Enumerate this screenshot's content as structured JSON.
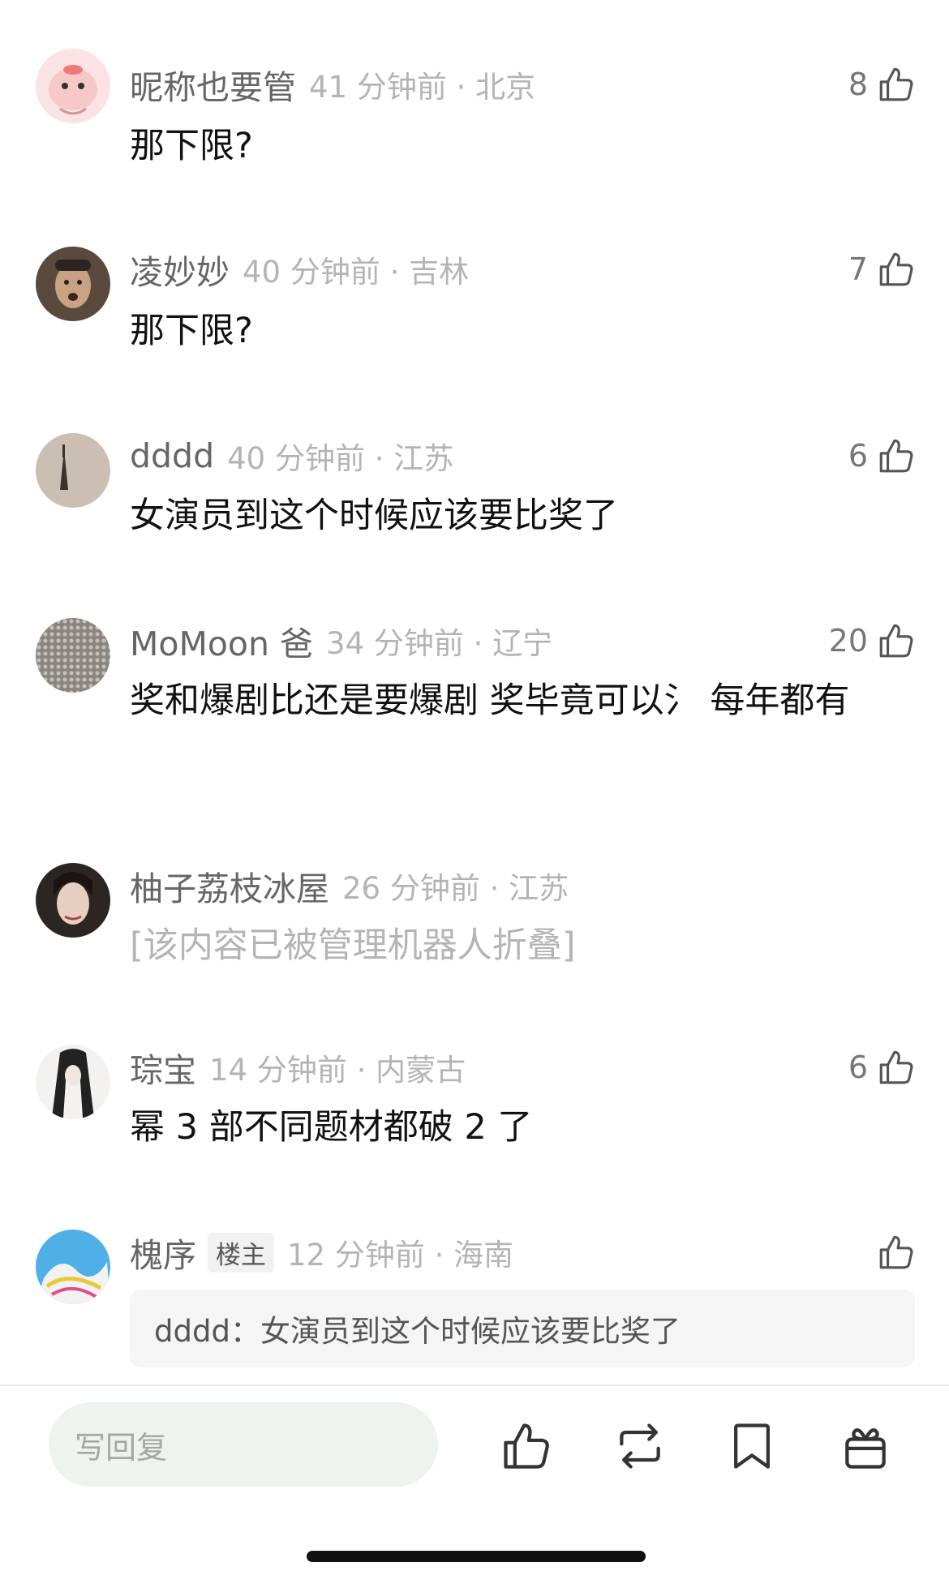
{
  "comments": [
    {
      "username": "昵称也要管",
      "time": "41 分钟前 · 北京",
      "likes": "8",
      "text": "那下限?"
    },
    {
      "username": "凌妙妙",
      "time": "40 分钟前 · 吉林",
      "likes": "7",
      "text": "那下限?"
    },
    {
      "username": "dddd",
      "time": "40 分钟前 · 江苏",
      "likes": "6",
      "text": "女演员到这个时候应该要比奖了"
    },
    {
      "username": "MoMoon 爸",
      "time": "34 分钟前 · 辽宁",
      "likes": "20",
      "text": "奖和爆剧比还是要爆剧 奖毕竟可以氵 每年都有"
    },
    {
      "username": "柚子荔枝冰屋",
      "time": "26 分钟前 · 江苏",
      "text": "[该内容已被管理机器人折叠]"
    },
    {
      "username": "琮宝",
      "time": "14 分钟前 · 内蒙古",
      "likes": "6",
      "text": "幂 3 部不同题材都破 2 了"
    },
    {
      "username": "槐序",
      "badge": "楼主",
      "time": "12 分钟前 · 海南",
      "quote_user": "dddd：",
      "quote_text": "女演员到这个时候应该要比奖了"
    }
  ],
  "bottom_bar": {
    "reply_placeholder": "写回复",
    "icons": [
      "thumbs-up-icon",
      "repost-icon",
      "bookmark-icon",
      "gift-icon"
    ]
  }
}
